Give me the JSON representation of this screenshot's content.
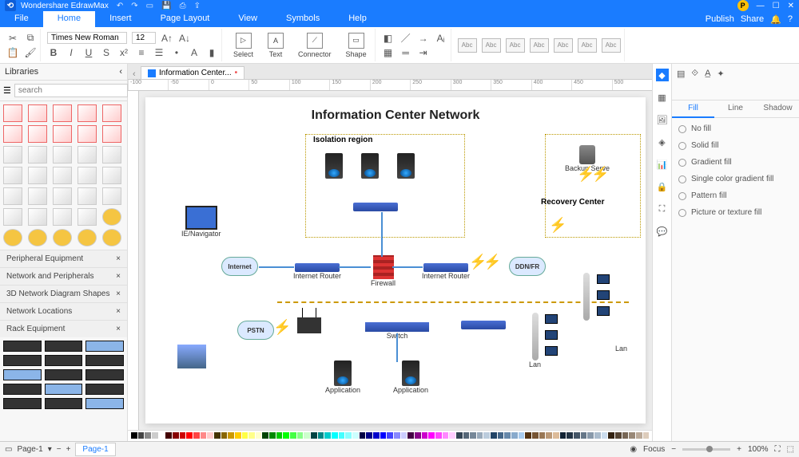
{
  "app": {
    "title": "Wondershare EdrawMax",
    "avatar_letter": "P"
  },
  "titlebar_actions": {
    "publish": "Publish",
    "share": "Share"
  },
  "menus": [
    "File",
    "Home",
    "Insert",
    "Page Layout",
    "View",
    "Symbols",
    "Help"
  ],
  "active_menu": "Home",
  "ribbon": {
    "font": "Times New Roman",
    "size": "12",
    "tools": {
      "select": "Select",
      "text": "Text",
      "connector": "Connector",
      "shape": "Shape"
    },
    "style_thumb": "Abc"
  },
  "libraries": {
    "header": "Libraries",
    "search_placeholder": "search",
    "categories": [
      "Peripheral Equipment",
      "Network and Peripherals",
      "3D Network Diagram Shapes",
      "Network Locations"
    ],
    "rack_header": "Rack Equipment"
  },
  "doc": {
    "tab_title": "Information Center..."
  },
  "diagram": {
    "title": "Information Center Network",
    "isolation_label": "Isolation region",
    "recovery_label": "Recovery Center",
    "backup_label": "Backup Serve",
    "ie_label": "IE/Navigator",
    "internet": "Internet",
    "internet_router": "Internet Router",
    "firewall": "Firewall",
    "ddn": "DDN/FR",
    "pstn": "PSTN",
    "switch": "Switch",
    "application": "Application",
    "lan": "Lan"
  },
  "prop": {
    "tabs": [
      "Fill",
      "Line",
      "Shadow"
    ],
    "active_tab": "Fill",
    "options": [
      "No fill",
      "Solid fill",
      "Gradient fill",
      "Single color gradient fill",
      "Pattern fill",
      "Picture or texture fill"
    ]
  },
  "status": {
    "page_label": "Page-1",
    "page_tab": "Page-1",
    "focus": "Focus",
    "zoom": "100%"
  },
  "swatches": [
    "#000",
    "#444",
    "#888",
    "#ccc",
    "#fff",
    "#400",
    "#800",
    "#c00",
    "#f00",
    "#f44",
    "#f88",
    "#fcc",
    "#430",
    "#860",
    "#c90",
    "#fc0",
    "#ff4",
    "#ff8",
    "#ffc",
    "#040",
    "#080",
    "#0c0",
    "#0f0",
    "#4f4",
    "#8f8",
    "#cfc",
    "#044",
    "#088",
    "#0cc",
    "#0ff",
    "#4ff",
    "#8ff",
    "#cff",
    "#004",
    "#008",
    "#00c",
    "#00f",
    "#44f",
    "#88f",
    "#ccf",
    "#404",
    "#808",
    "#c0c",
    "#f0f",
    "#f4f",
    "#f8f",
    "#fcf",
    "#345",
    "#567",
    "#789",
    "#9ab",
    "#bcd",
    "#246",
    "#468",
    "#68a",
    "#8ac",
    "#ace",
    "#531",
    "#753",
    "#975",
    "#b97",
    "#db9",
    "#123",
    "#234",
    "#456",
    "#678",
    "#89a",
    "#abc",
    "#cde",
    "#321",
    "#543",
    "#765",
    "#987",
    "#ba9",
    "#dcb"
  ]
}
